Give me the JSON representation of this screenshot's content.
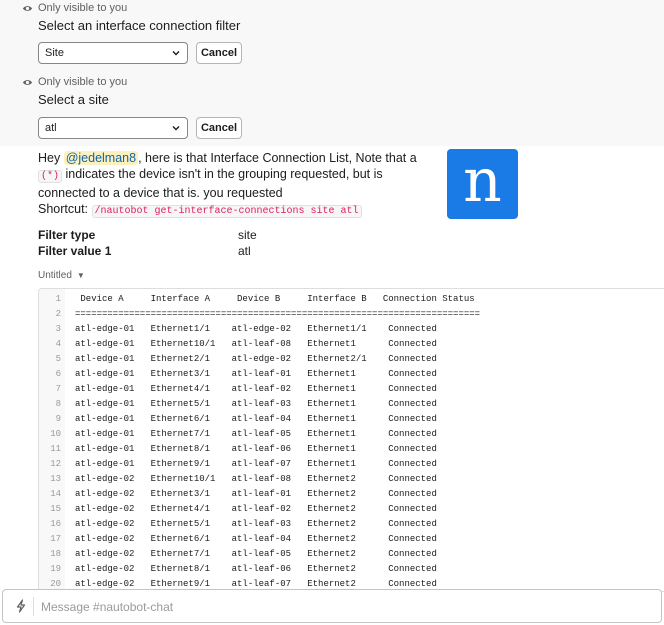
{
  "ephemeral1": {
    "visibility_note": "Only visible to you",
    "title": "Select an interface connection filter",
    "select_value": "Site",
    "cancel_label": "Cancel"
  },
  "ephemeral2": {
    "visibility_note": "Only visible to you",
    "title": "Select a site",
    "select_value": "atl",
    "cancel_label": "Cancel"
  },
  "message": {
    "greeting": "Hey ",
    "mention": "@jedelman8",
    "text1": ", here is that Interface Connection List, Note that a ",
    "marker": "(*)",
    "text2": " indicates the device isn't in the grouping requested, but is connected to a device that is. you requested",
    "shortcut_label": "Shortcut: ",
    "shortcut_cmd": "/nautobot get-interface-connections site atl",
    "logo_letter": "n",
    "logo_color": "#1a7be6"
  },
  "fields": [
    {
      "name": "Filter type",
      "value": "site"
    },
    {
      "name": "Filter value 1",
      "value": "atl"
    }
  ],
  "snippet": {
    "title": "Untitled",
    "lines": [
      {
        "n": "1",
        "text": " Device A     Interface A     Device B     Interface B   Connection Status"
      },
      {
        "n": "2",
        "text": "==========================================================================="
      },
      {
        "n": "3",
        "text": "atl-edge-01   Ethernet1/1    atl-edge-02   Ethernet1/1    Connected"
      },
      {
        "n": "4",
        "text": "atl-edge-01   Ethernet10/1   atl-leaf-08   Ethernet1      Connected"
      },
      {
        "n": "5",
        "text": "atl-edge-01   Ethernet2/1    atl-edge-02   Ethernet2/1    Connected"
      },
      {
        "n": "6",
        "text": "atl-edge-01   Ethernet3/1    atl-leaf-01   Ethernet1      Connected"
      },
      {
        "n": "7",
        "text": "atl-edge-01   Ethernet4/1    atl-leaf-02   Ethernet1      Connected"
      },
      {
        "n": "8",
        "text": "atl-edge-01   Ethernet5/1    atl-leaf-03   Ethernet1      Connected"
      },
      {
        "n": "9",
        "text": "atl-edge-01   Ethernet6/1    atl-leaf-04   Ethernet1      Connected"
      },
      {
        "n": "10",
        "text": "atl-edge-01   Ethernet7/1    atl-leaf-05   Ethernet1      Connected"
      },
      {
        "n": "11",
        "text": "atl-edge-01   Ethernet8/1    atl-leaf-06   Ethernet1      Connected"
      },
      {
        "n": "12",
        "text": "atl-edge-01   Ethernet9/1    atl-leaf-07   Ethernet1      Connected"
      },
      {
        "n": "13",
        "text": "atl-edge-02   Ethernet10/1   atl-leaf-08   Ethernet2      Connected"
      },
      {
        "n": "14",
        "text": "atl-edge-02   Ethernet3/1    atl-leaf-01   Ethernet2      Connected"
      },
      {
        "n": "15",
        "text": "atl-edge-02   Ethernet4/1    atl-leaf-02   Ethernet2      Connected"
      },
      {
        "n": "16",
        "text": "atl-edge-02   Ethernet5/1    atl-leaf-03   Ethernet2      Connected"
      },
      {
        "n": "17",
        "text": "atl-edge-02   Ethernet6/1    atl-leaf-04   Ethernet2      Connected"
      },
      {
        "n": "18",
        "text": "atl-edge-02   Ethernet7/1    atl-leaf-05   Ethernet2      Connected"
      },
      {
        "n": "19",
        "text": "atl-edge-02   Ethernet8/1    atl-leaf-06   Ethernet2      Connected"
      },
      {
        "n": "20",
        "text": "atl-edge-02   Ethernet9/1    atl-leaf-07   Ethernet2      Connected"
      }
    ]
  },
  "composer": {
    "placeholder": "Message #nautobot-chat",
    "icon": "lightning-icon"
  }
}
